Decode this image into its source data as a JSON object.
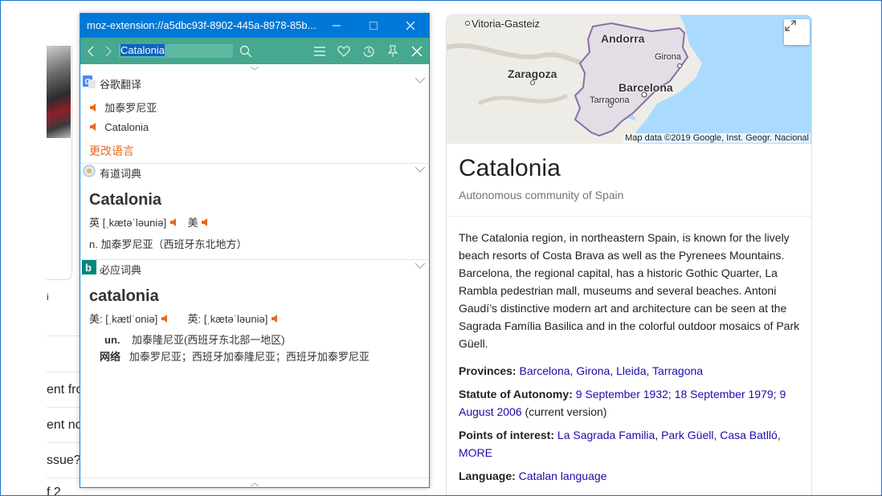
{
  "background": {
    "snippets": [
      "ent fro",
      "ent nov",
      "ssue?",
      "f 2"
    ],
    "marker": "i"
  },
  "knowledge_panel": {
    "map": {
      "cities": {
        "vitoria": "Vitoria-Gasteiz",
        "andorra": "Andorra",
        "zaragoza": "Zaragoza",
        "girona": "Girona",
        "barcelona": "Barcelona",
        "tarragona": "Tarragona"
      },
      "credit": "Map data ©2019 Google, Inst. Geogr. Nacional",
      "expand_icon": "expand-icon"
    },
    "title": "Catalonia",
    "subtitle": "Autonomous community of Spain",
    "description": "The Catalonia region, in northeastern Spain, is known for the lively beach resorts of Costa Brava as well as the Pyrenees Mountains. Barcelona, the regional capital, has a historic Gothic Quarter, La Rambla pedestrian mall, museums and several beaches. Antoni Gaudí’s distinctive modern art and architecture can be seen at the Sagrada Família Basilica and in the colorful outdoor mosaics of Park Güell.",
    "provinces": {
      "label": "Provinces:",
      "items": [
        "Barcelona",
        "Girona",
        "Lleida",
        "Tarragona"
      ]
    },
    "statute": {
      "label": "Statute of Autonomy:",
      "links": [
        "9 September 1932",
        "18 September 1979",
        "9 August 2006"
      ],
      "suffix": "(current version)"
    },
    "poi": {
      "label": "Points of interest:",
      "items": [
        "La Sagrada Familia",
        "Park Güell",
        "Casa Batlló",
        "MORE"
      ]
    },
    "language": {
      "label": "Language:",
      "value": "Catalan language"
    }
  },
  "popup": {
    "title": "moz-extension://a5dbc93f-8902-445a-8978-85b...",
    "search_value": "Catalonia",
    "google": {
      "header": "谷歌翻译",
      "result_zh": "加泰罗尼亚",
      "result_en": "Catalonia",
      "change_lang": "更改语言"
    },
    "youdao": {
      "header": "有道词典",
      "word": "Catalonia",
      "phon_uk_label": "英",
      "phon_uk": "[ˌkætəˈləuniə]",
      "phon_us_label": "美",
      "pos": "n.",
      "meaning": "加泰罗尼亚（西班牙东北地方）"
    },
    "bing": {
      "header": "必应词典",
      "word": "catalonia",
      "phon_us_label": "美:",
      "phon_us": "[ˌkætlˈoniə]",
      "phon_uk_label": "英:",
      "phon_uk": "[ˌkætəˈləuniə]",
      "def1_pos": "un.",
      "def1": "加泰隆尼亚(西班牙东北部一地区)",
      "def2_pos": "网络",
      "def2": "加泰罗尼亚；西班牙加泰隆尼亚；西班牙加泰罗尼亚"
    }
  }
}
